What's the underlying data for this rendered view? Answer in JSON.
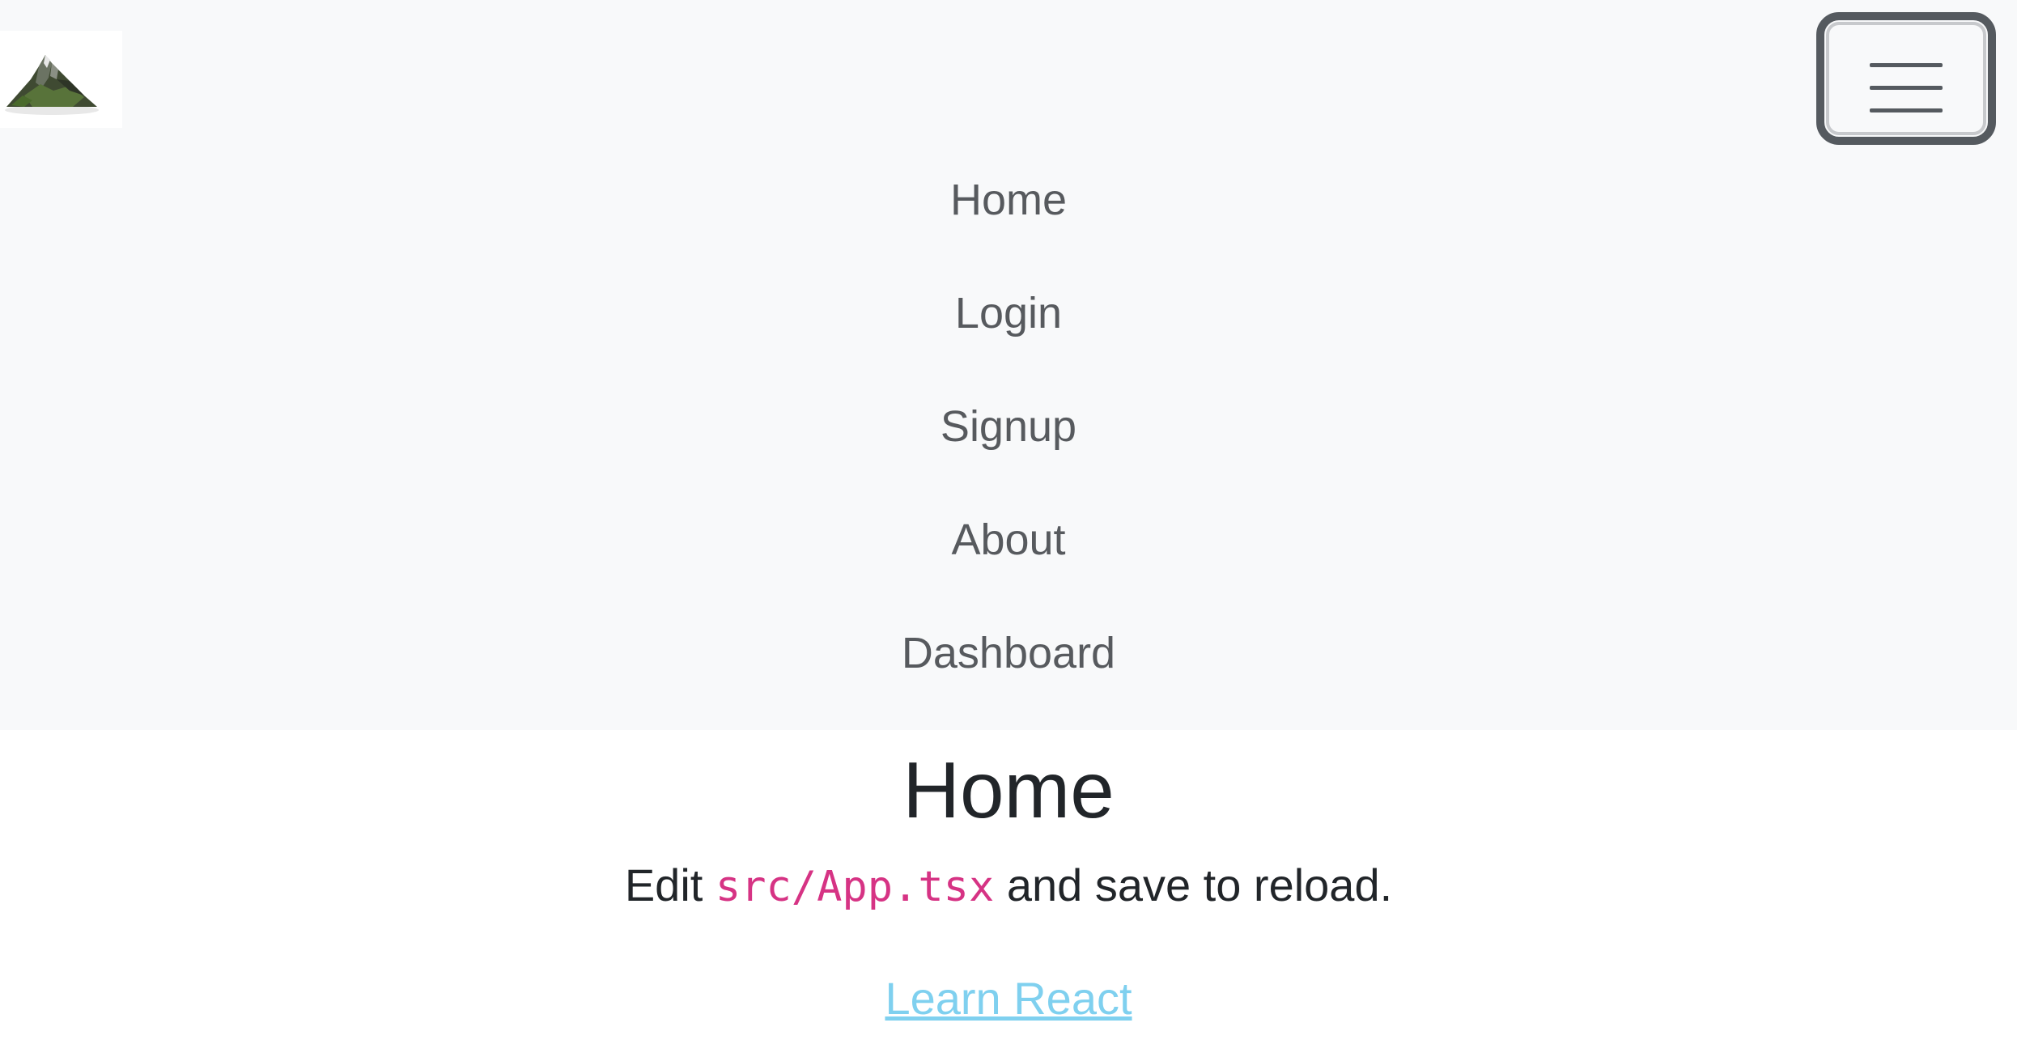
{
  "navbar": {
    "brand_logo": "mountain-logo",
    "toggler_icon": "hamburger-menu-icon",
    "links": [
      {
        "label": "Home"
      },
      {
        "label": "Login"
      },
      {
        "label": "Signup"
      },
      {
        "label": "About"
      },
      {
        "label": "Dashboard"
      }
    ]
  },
  "main": {
    "title": "Home",
    "edit_prefix": "Edit ",
    "edit_code": "src/App.tsx",
    "edit_suffix": " and save to reload.",
    "learn_link": "Learn React"
  },
  "colors": {
    "navbar_bg": "#f8f9fa",
    "nav_link": "#575a5e",
    "code": "#d63384",
    "link": "#7fd0ef",
    "text": "#212529"
  }
}
